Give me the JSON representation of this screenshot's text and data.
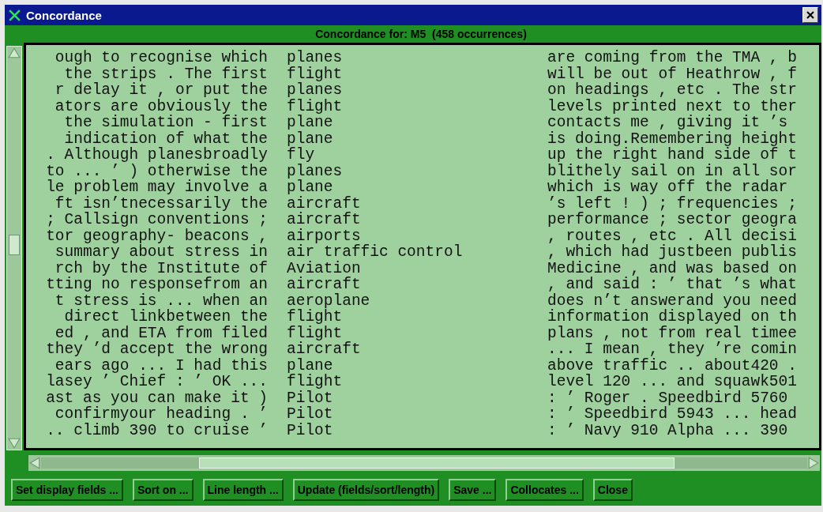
{
  "window": {
    "title": "Concordance"
  },
  "header": "Concordance for: M5  (458 occurrences)",
  "lines": [
    {
      "left": "ough to recognise which",
      "keyword": "planes",
      "right": "are coming from the TMA , b"
    },
    {
      "left": "the strips . The first",
      "keyword": "flight",
      "right": "will be out of Heathrow , f"
    },
    {
      "left": "r delay it , or put the",
      "keyword": "planes",
      "right": "on headings , etc . The str"
    },
    {
      "left": "ators are obviously the",
      "keyword": "flight",
      "right": "levels printed next to ther"
    },
    {
      "left": "the simulation - first",
      "keyword": "plane",
      "right": "contacts me , giving it ’s"
    },
    {
      "left": "indication of what the",
      "keyword": "plane",
      "right": "is doing.Remembering height"
    },
    {
      "left": ". Although planesbroadly",
      "keyword": "fly",
      "right": "up the right hand side of t"
    },
    {
      "left": "to ... ’ ) otherwise the",
      "keyword": "planes",
      "right": "blithely sail on in all sor"
    },
    {
      "left": "le problem may involve a",
      "keyword": "plane",
      "right": "which is way off the radar"
    },
    {
      "left": "ft isn’tnecessarily the",
      "keyword": "aircraft",
      "right": "’s left ! ) ; frequencies ;"
    },
    {
      "left": "; Callsign conventions ;",
      "keyword": "aircraft",
      "right": "performance ; sector geogra"
    },
    {
      "left": "tor geography- beacons ,",
      "keyword": "airports",
      "right": ", routes , etc . All decisi"
    },
    {
      "left": "summary about stress in",
      "keyword": "air traffic control",
      "right": ", which had justbeen publis"
    },
    {
      "left": "rch by the Institute of",
      "keyword": "Aviation",
      "right": "Medicine , and was based on"
    },
    {
      "left": "tting no responsefrom an",
      "keyword": "aircraft",
      "right": ", and said : ’ that ’s what"
    },
    {
      "left": "t stress is ... when an",
      "keyword": "aeroplane",
      "right": "does n’t answerand you need"
    },
    {
      "left": "direct linkbetween the",
      "keyword": "flight",
      "right": "information displayed on th"
    },
    {
      "left": "ed , and ETA from filed",
      "keyword": "flight",
      "right": "plans , not from real timee"
    },
    {
      "left": "they ’d accept the wrong",
      "keyword": "aircraft",
      "right": "... I mean , they ’re comin"
    },
    {
      "left": "ears ago ... I had this",
      "keyword": "plane",
      "right": "above traffic .. about420 ."
    },
    {
      "left": "lasey ’ Chief : ’ OK ...",
      "keyword": "flight",
      "right": "level 120 ... and squawk501"
    },
    {
      "left": "ast as you can make it )",
      "keyword": "Pilot",
      "right": ": ’ Roger . Speedbird 5760"
    },
    {
      "left": "confirmyour heading . ’",
      "keyword": "Pilot",
      "right": ": ’ Speedbird 5943 ... head"
    },
    {
      "left": ".. climb 390 to cruise ’",
      "keyword": "Pilot",
      "right": ": ’ Navy 910 Alpha ... 390"
    }
  ],
  "buttons": [
    "Set display fields ...",
    "Sort on ...",
    "Line length ...",
    "Update (fields/sort/length)",
    "Save ...",
    "Collocates ...",
    "Close"
  ]
}
